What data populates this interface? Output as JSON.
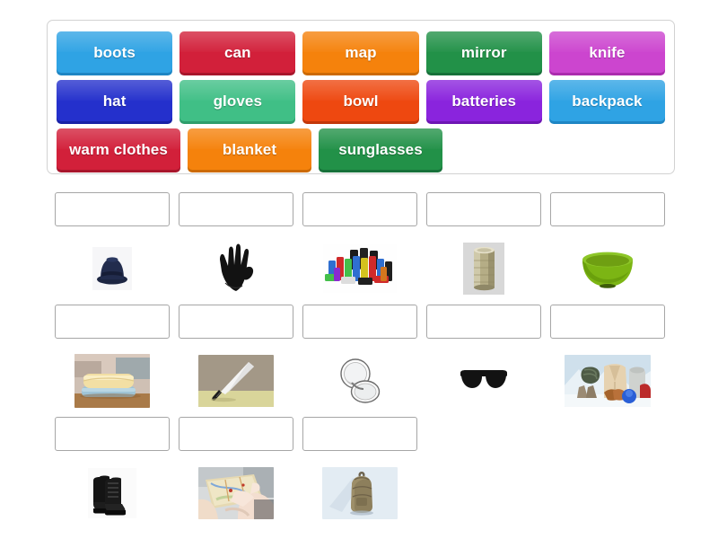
{
  "activity": {
    "type": "match-up",
    "background_color": "#ffffff"
  },
  "word_bank": {
    "border_color": "#d2d2d2",
    "rows": [
      [
        {
          "label": "boots",
          "color": "#2fa3e4",
          "edge": "#1e86c4",
          "icon": "boots-tile"
        },
        {
          "label": "can",
          "color": "#d2203a",
          "edge": "#a8162c",
          "icon": "can-tile"
        },
        {
          "label": "map",
          "color": "#f5820c",
          "edge": "#cc6a04",
          "icon": "map-tile"
        },
        {
          "label": "mirror",
          "color": "#229148",
          "edge": "#17713a",
          "icon": "mirror-tile"
        },
        {
          "label": "knife",
          "color": "#cc45cf",
          "edge": "#ab2cae",
          "icon": "knife-tile"
        }
      ],
      [
        {
          "label": "hat",
          "color": "#2430cc",
          "edge": "#1821a6",
          "icon": "hat-tile"
        },
        {
          "label": "gloves",
          "color": "#40bf86",
          "edge": "#2e9e6b",
          "icon": "gloves-tile"
        },
        {
          "label": "bowl",
          "color": "#ee4810",
          "edge": "#c33709",
          "icon": "bowl-tile"
        },
        {
          "label": "batteries",
          "color": "#8a24dd",
          "edge": "#6e16b4",
          "icon": "batteries-tile"
        },
        {
          "label": "backpack",
          "color": "#2fa3e4",
          "edge": "#1e86c4",
          "icon": "backpack-tile"
        }
      ],
      [
        {
          "label": "warm clothes",
          "color": "#d2203a",
          "edge": "#a8162c",
          "icon": "warm-clothes-tile"
        },
        {
          "label": "blanket",
          "color": "#f5820c",
          "edge": "#cc6a04",
          "icon": "blanket-tile"
        },
        {
          "label": "sunglasses",
          "color": "#229148",
          "edge": "#17713a",
          "icon": "sunglasses-tile"
        }
      ]
    ]
  },
  "answers": {
    "drop_zone_border": "#a6a6a6",
    "drop_zone_value": "",
    "rows": [
      [
        {
          "image": "hat-photo",
          "answer": ""
        },
        {
          "image": "gloves-photo",
          "answer": ""
        },
        {
          "image": "batteries-photo",
          "answer": ""
        },
        {
          "image": "can-photo",
          "answer": ""
        },
        {
          "image": "bowl-photo",
          "answer": ""
        }
      ],
      [
        {
          "image": "blanket-photo",
          "answer": ""
        },
        {
          "image": "knife-photo",
          "answer": ""
        },
        {
          "image": "mirror-photo",
          "answer": ""
        },
        {
          "image": "sunglasses-photo",
          "answer": ""
        },
        {
          "image": "warm-clothes-photo",
          "answer": ""
        }
      ],
      [
        {
          "image": "boots-photo",
          "answer": ""
        },
        {
          "image": "map-photo",
          "answer": ""
        },
        {
          "image": "backpack-photo",
          "answer": ""
        }
      ]
    ]
  }
}
